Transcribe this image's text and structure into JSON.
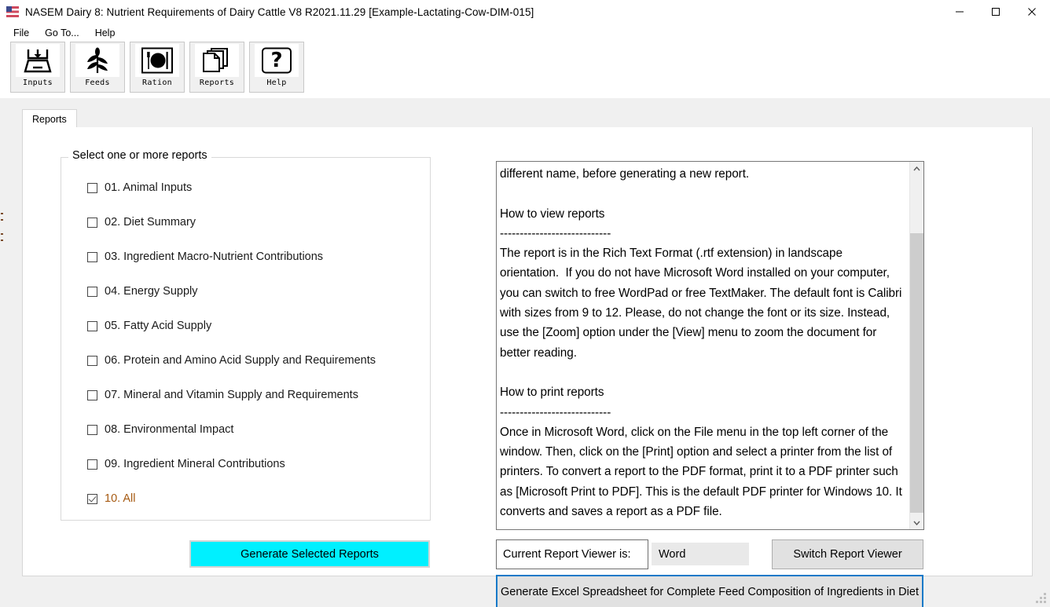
{
  "window": {
    "title": "NASEM Dairy 8: Nutrient Requirements of Dairy Cattle  V8 R2021.11.29 [Example-Lactating-Cow-DIM-015]",
    "icon": "us-flag-icon",
    "controls": {
      "minimize": "minimize-icon",
      "maximize": "maximize-icon",
      "close": "close-icon"
    }
  },
  "menubar": {
    "items": [
      {
        "label": "File"
      },
      {
        "label": "Go To..."
      },
      {
        "label": "Help"
      }
    ]
  },
  "toolbar": {
    "buttons": [
      {
        "label": "Inputs",
        "icon": "import-tray-icon"
      },
      {
        "label": "Feeds",
        "icon": "corn-plant-icon"
      },
      {
        "label": "Ration",
        "icon": "plate-fork-knife-icon"
      },
      {
        "label": "Reports",
        "icon": "stacked-pages-icon"
      },
      {
        "label": "Help",
        "icon": "question-mark-icon"
      }
    ]
  },
  "tabs": [
    {
      "label": "Reports",
      "active": true
    }
  ],
  "reports_group": {
    "legend": "Select one or more reports",
    "items": [
      {
        "label": "01. Animal Inputs",
        "checked": false
      },
      {
        "label": "02. Diet Summary",
        "checked": false
      },
      {
        "label": "03. Ingredient Macro-Nutrient Contributions",
        "checked": false
      },
      {
        "label": "04. Energy Supply",
        "checked": false
      },
      {
        "label": "05. Fatty Acid Supply",
        "checked": false
      },
      {
        "label": "06. Protein and Amino Acid Supply and Requirements",
        "checked": false
      },
      {
        "label": "07. Mineral and Vitamin Supply and Requirements",
        "checked": false
      },
      {
        "label": "08. Environmental Impact",
        "checked": false
      },
      {
        "label": "09. Ingredient Mineral Contributions",
        "checked": false
      },
      {
        "label": "10. All",
        "checked": true
      }
    ]
  },
  "generate_button": {
    "label": "Generate Selected Reports",
    "color": "#00f0ff"
  },
  "help_text": {
    "content": "different name, before generating a new report.\n\nHow to view reports\n----------------------------\nThe report is in the Rich Text Format (.rtf extension) in landscape orientation.  If you do not have Microsoft Word installed on your computer, you can switch to free WordPad or free TextMaker. The default font is Calibri with sizes from 9 to 12. Please, do not change the font or its size. Instead, use the [Zoom] option under the [View] menu to zoom the document for better reading.\n\nHow to print reports\n----------------------------\nOnce in Microsoft Word, click on the File menu in the top left corner of the window. Then, click on the [Print] option and select a printer from the list of printers. To convert a report to the PDF format, print it to a PDF printer such as [Microsoft Print to PDF]. This is the default PDF printer for Windows 10. It converts and saves a report as a PDF file."
  },
  "scrollbar": {
    "up_arrow": "chevron-up-icon",
    "down_arrow": "chevron-down-icon"
  },
  "viewer": {
    "label": "Current Report Viewer is:",
    "value": "Word",
    "switch_label": "Switch Report Viewer"
  },
  "excel_button": {
    "label": "Generate Excel Spreadsheet for Complete Feed Composition of Ingredients in Diet",
    "border_color": "#1479c8"
  }
}
